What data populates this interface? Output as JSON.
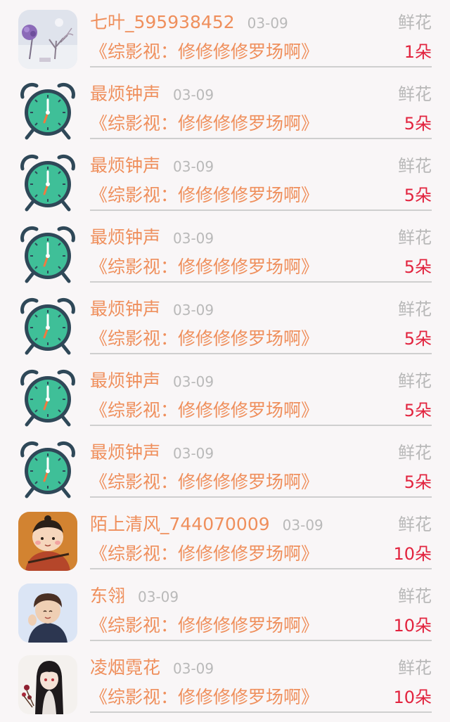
{
  "records": [
    {
      "name": "七叶_595938452",
      "date": "03-09",
      "gift": "鲜花",
      "work": "《综影视：修修修修罗场啊》",
      "count": "1朵",
      "avatar": "flower-tree-avatar"
    },
    {
      "name": "最烦钟声",
      "date": "03-09",
      "gift": "鲜花",
      "work": "《综影视：修修修修罗场啊》",
      "count": "5朵",
      "avatar": "alarm-clock-icon"
    },
    {
      "name": "最烦钟声",
      "date": "03-09",
      "gift": "鲜花",
      "work": "《综影视：修修修修罗场啊》",
      "count": "5朵",
      "avatar": "alarm-clock-icon"
    },
    {
      "name": "最烦钟声",
      "date": "03-09",
      "gift": "鲜花",
      "work": "《综影视：修修修修罗场啊》",
      "count": "5朵",
      "avatar": "alarm-clock-icon"
    },
    {
      "name": "最烦钟声",
      "date": "03-09",
      "gift": "鲜花",
      "work": "《综影视：修修修修罗场啊》",
      "count": "5朵",
      "avatar": "alarm-clock-icon"
    },
    {
      "name": "最烦钟声",
      "date": "03-09",
      "gift": "鲜花",
      "work": "《综影视：修修修修罗场啊》",
      "count": "5朵",
      "avatar": "alarm-clock-icon"
    },
    {
      "name": "最烦钟声",
      "date": "03-09",
      "gift": "鲜花",
      "work": "《综影视：修修修修罗场啊》",
      "count": "5朵",
      "avatar": "alarm-clock-icon"
    },
    {
      "name": "陌上清风_744070009",
      "date": "03-09",
      "gift": "鲜花",
      "work": "《综影视：修修修修罗场啊》",
      "count": "10朵",
      "avatar": "cartoon-boy-avatar"
    },
    {
      "name": "东翎",
      "date": "03-09",
      "gift": "鲜花",
      "work": "《综影视：修修修修罗场啊》",
      "count": "10朵",
      "avatar": "child-photo-avatar"
    },
    {
      "name": "凌烟霓花",
      "date": "03-09",
      "gift": "鲜花",
      "work": "《综影视：修修修修罗场啊》",
      "count": "10朵",
      "avatar": "anime-girl-avatar"
    }
  ]
}
